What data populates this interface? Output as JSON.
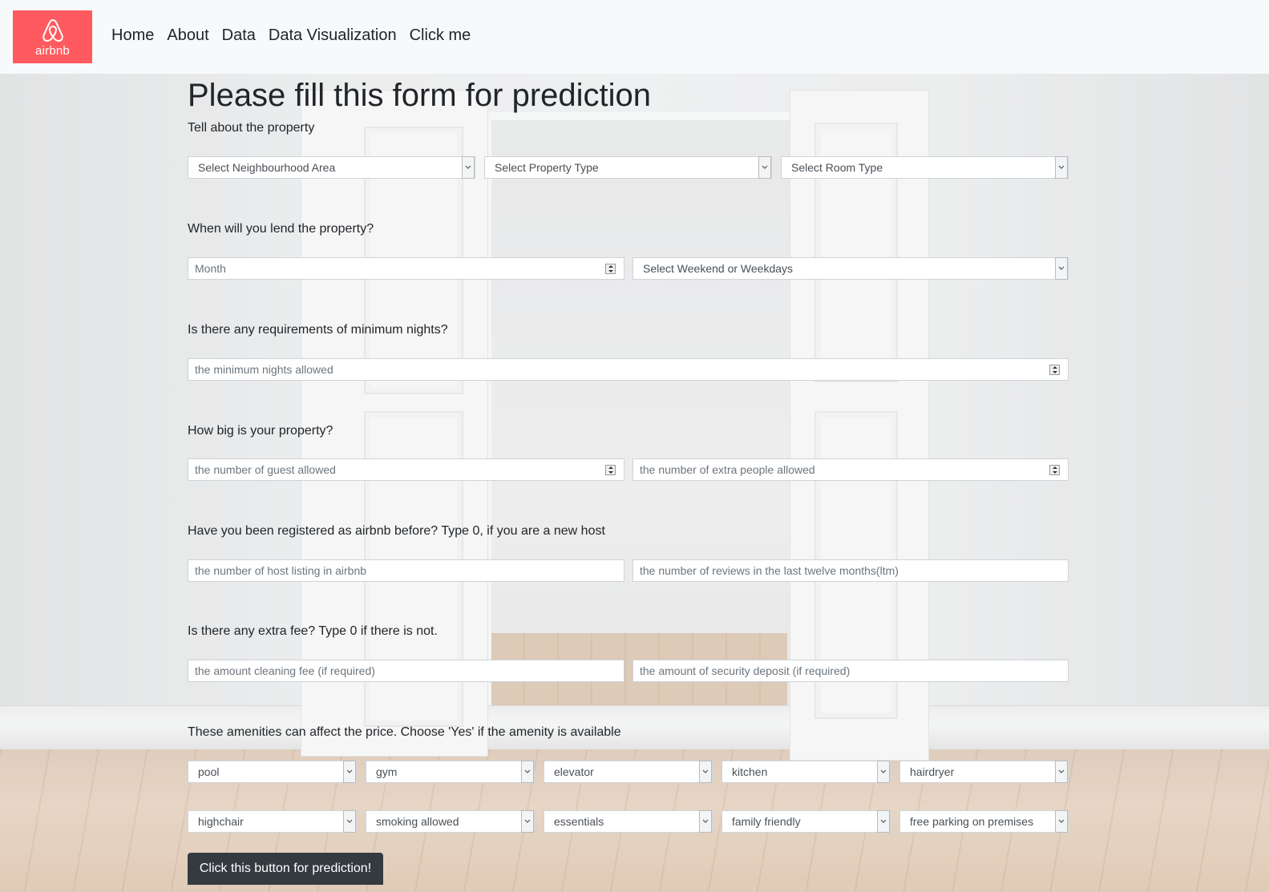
{
  "brand": {
    "logo_text": "airbnb",
    "color": "#ff5a5f"
  },
  "nav": [
    "Home",
    "About",
    "Data",
    "Data Visualization",
    "Click me"
  ],
  "form": {
    "title": "Please fill this form for prediction",
    "sections": {
      "property": "Tell about the property",
      "when": "When will you lend the property?",
      "min_nights": "Is there any requirements of minimum nights?",
      "size": "How big is your property?",
      "host": "Have you been registered as airbnb before? Type 0, if you are a new host",
      "fee": "Is there any extra fee? Type 0 if there is not.",
      "amenities": "These amenities can affect the price. Choose 'Yes' if the amenity is available"
    },
    "selects": {
      "neighbourhood": "Select Neighbourhood Area",
      "property_type": "Select Property Type",
      "room_type": "Select Room Type",
      "weekend": "Select Weekend or Weekdays"
    },
    "inputs": {
      "month": "Month",
      "min_nights": "the minimum nights allowed",
      "guests": "the number of guest allowed",
      "extra_people": "the number of extra people allowed",
      "host_listings": "the number of host listing in airbnb",
      "reviews_ltm": "the number of reviews in the last twelve months(ltm)",
      "cleaning_fee": "the amount cleaning fee (if required)",
      "security_deposit": "the amount of security deposit (if required)"
    },
    "amenities": [
      "pool",
      "gym",
      "elevator",
      "kitchen",
      "hairdryer",
      "highchair",
      "smoking allowed",
      "essentials",
      "family friendly",
      "free parking on premises"
    ],
    "submit": "Click this button for prediction!"
  }
}
